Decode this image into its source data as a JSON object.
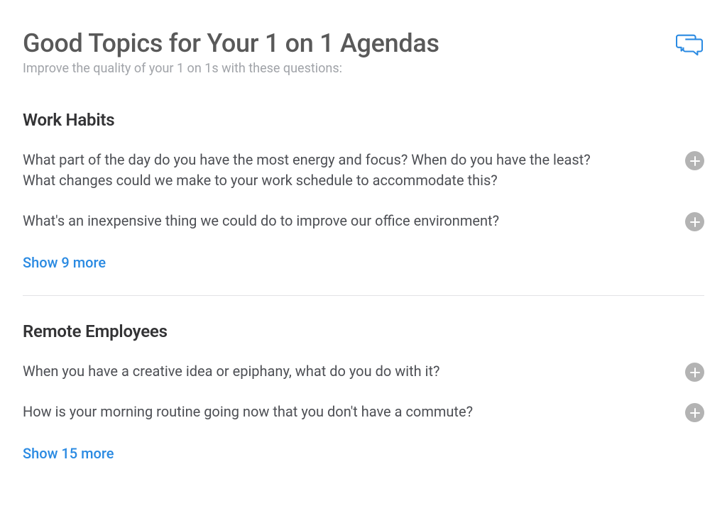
{
  "header": {
    "title": "Good Topics for Your 1 on 1 Agendas",
    "subtitle": "Improve the quality of your 1 on 1s with these questions:"
  },
  "sections": [
    {
      "title": "Work Habits",
      "questions": [
        "What part of the day do you have the most energy and focus? When do you have the least? What changes could we make to your work schedule to accommodate this?",
        "What's an inexpensive thing we could do to improve our office environment?"
      ],
      "show_more_label": "Show 9 more"
    },
    {
      "title": "Remote Employees",
      "questions": [
        "When you have a creative idea or epiphany, what do you do with it?",
        "How is your morning routine going now that you don't have a commute?"
      ],
      "show_more_label": "Show 15 more"
    }
  ],
  "colors": {
    "link": "#2a8ae2",
    "icon": "#2a8ae2",
    "add_bg": "#b3b3b3"
  }
}
